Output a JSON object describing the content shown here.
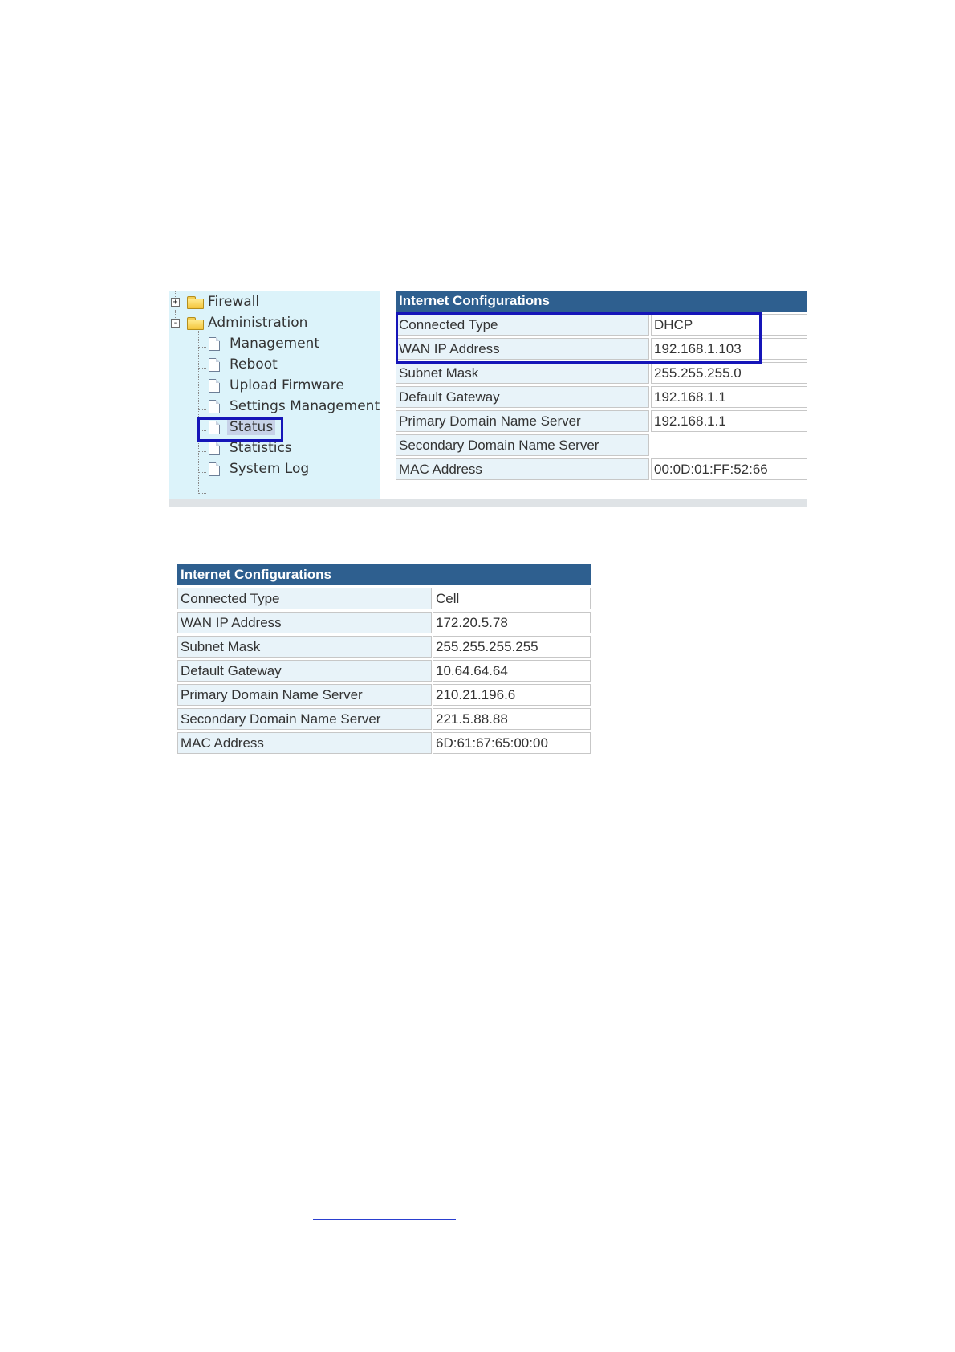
{
  "tree": {
    "items": [
      {
        "label": "Firewall",
        "icon": "folder-icon",
        "expander": "+"
      },
      {
        "label": "Administration",
        "icon": "folder-open-icon",
        "expander": "-"
      },
      {
        "label": "Management",
        "icon": "page-icon"
      },
      {
        "label": "Reboot",
        "icon": "page-icon"
      },
      {
        "label": "Upload Firmware",
        "icon": "page-icon"
      },
      {
        "label": "Settings Management",
        "icon": "page-icon"
      },
      {
        "label": "Status",
        "icon": "page-icon",
        "selected": true
      },
      {
        "label": "Statistics",
        "icon": "page-icon"
      },
      {
        "label": "System Log",
        "icon": "page-icon"
      }
    ]
  },
  "table1": {
    "title": "Internet Configurations",
    "rows": [
      {
        "label": "Connected Type",
        "value": "DHCP"
      },
      {
        "label": "WAN IP Address",
        "value": "192.168.1.103"
      },
      {
        "label": "Subnet Mask",
        "value": "255.255.255.0"
      },
      {
        "label": "Default Gateway",
        "value": "192.168.1.1"
      },
      {
        "label": "Primary Domain Name Server",
        "value": "192.168.1.1"
      },
      {
        "label": "Secondary Domain Name Server",
        "value": ""
      },
      {
        "label": "MAC Address",
        "value": "00:0D:01:FF:52:66"
      }
    ]
  },
  "table2": {
    "title": "Internet Configurations",
    "rows": [
      {
        "label": "Connected Type",
        "value": "Cell"
      },
      {
        "label": "WAN IP Address",
        "value": "172.20.5.78"
      },
      {
        "label": "Subnet Mask",
        "value": "255.255.255.255"
      },
      {
        "label": "Default Gateway",
        "value": "10.64.64.64"
      },
      {
        "label": "Primary Domain Name Server",
        "value": "210.21.196.6"
      },
      {
        "label": "Secondary Domain Name Server",
        "value": "221.5.88.88"
      },
      {
        "label": "MAC Address",
        "value": "6D:61:67:65:00:00"
      }
    ]
  },
  "colors": {
    "header_bg": "#2e5f8f",
    "tree_bg": "#dcf3fa",
    "label_cell_bg": "#e8f3f9",
    "highlight_border": "#1515b8",
    "link_underline": "#2a3fd0"
  }
}
